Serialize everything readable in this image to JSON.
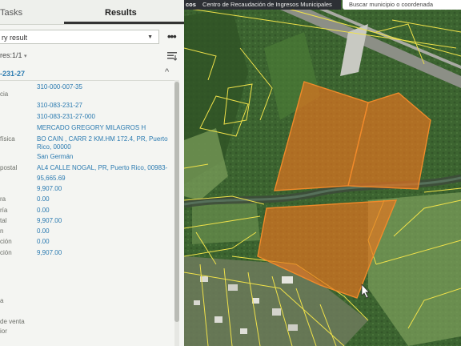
{
  "tabs": {
    "tasks": "Tasks",
    "results": "Results"
  },
  "dropdown": {
    "value": "ry result"
  },
  "more_menu": "•••",
  "features": {
    "label": "res:1/1",
    "caret": "▾"
  },
  "record": {
    "id": "-231-27",
    "collapse": "^"
  },
  "attributes": [
    {
      "label": "",
      "value": "310-000-007-35"
    },
    {
      "label": "cia",
      "value": ""
    },
    {
      "label": "",
      "value": "310-083-231-27"
    },
    {
      "label": "",
      "value": "310-083-231-27-000"
    },
    {
      "label": "",
      "value": "MERCADO GREGORY MILAGROS H"
    },
    {
      "label": "física",
      "value": "BO CAIN , CARR 2 KM.HM 172.4, PR, Puerto Rico, 00000"
    },
    {
      "label": "",
      "value": "San Germán"
    },
    {
      "label": "postal",
      "value": "AL4 CALLE NOGAL, PR, Puerto Rico, 00983-"
    },
    {
      "label": "",
      "value": "95,665.69"
    },
    {
      "label": "",
      "value": "9,907.00"
    },
    {
      "label": "ra",
      "value": "0.00"
    },
    {
      "label": "ría",
      "value": "0.00"
    },
    {
      "label": "tal",
      "value": "9,907.00"
    },
    {
      "label": "n",
      "value": "0.00"
    },
    {
      "label": "ción",
      "value": "0.00"
    },
    {
      "label": "ción",
      "value": "9,907.00"
    },
    {
      "label": "a",
      "value": ""
    },
    {
      "label": "de venta",
      "value": ""
    },
    {
      "label": "ior",
      "value": ""
    }
  ],
  "map": {
    "brand": "cos",
    "title": "Centro de Recaudación de Ingresos Municipales",
    "search_placeholder": "Buscar municipio o coordenada",
    "highlight_color": "#e8741f",
    "parcel_line_color": "#f0e24a"
  }
}
